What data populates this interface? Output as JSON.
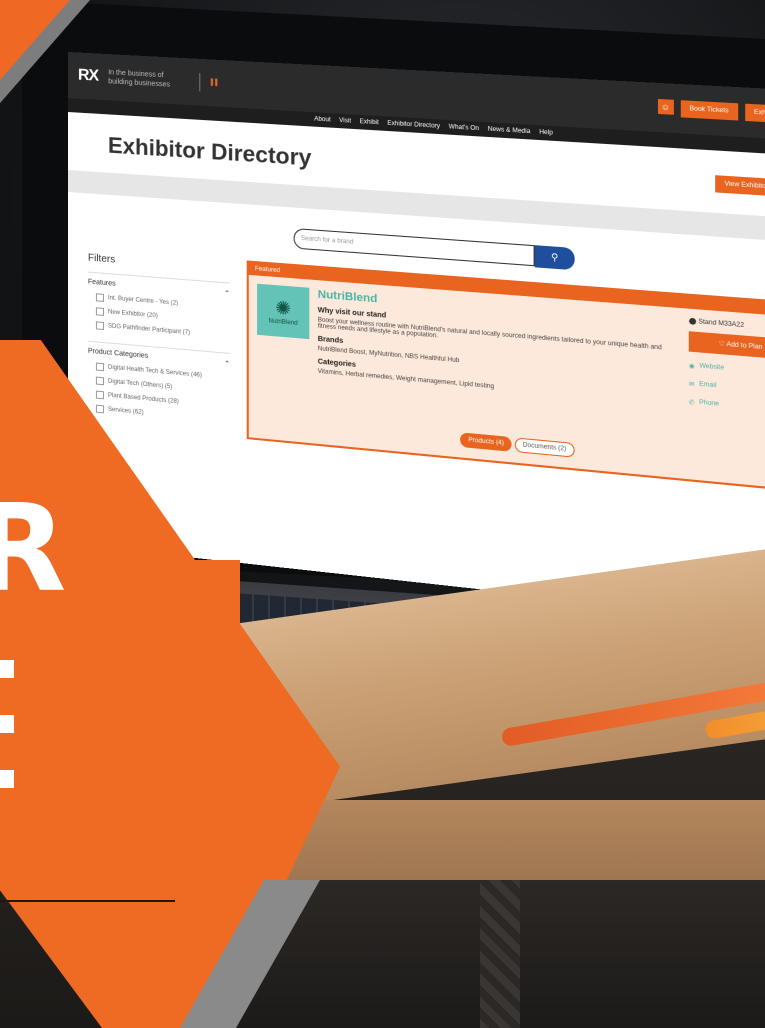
{
  "site": {
    "logo": "RX",
    "tagline": "In the business of building businesses",
    "event_name": "",
    "top_buttons": [
      "Book Tickets",
      "Exhibitor Enquiry"
    ],
    "nav": [
      "About",
      "Visit",
      "Exhibit",
      "Exhibitor Directory",
      "What's On",
      "News & Media",
      "Help"
    ],
    "title": "Exhibitor Directory",
    "cta": "View Exhibitors",
    "search_placeholder": "Search for a brand",
    "filters": {
      "heading": "Filters",
      "groups": [
        {
          "label": "Features",
          "options": [
            "Int. Buyer Centre - Yes (2)",
            "New Exhibitor (20)",
            "SDG Pathfinder Participant (7)"
          ]
        },
        {
          "label": "Product Categories",
          "options": [
            "Digital Health Tech & Services (46)",
            "Digital Tech (Others) (5)",
            "Plant Based Products (28)",
            "Services (62)"
          ]
        }
      ]
    },
    "card": {
      "header": "Featured",
      "logo_text": "NutriBlend",
      "name": "NutriBlend",
      "why_visit_label": "Why visit our stand",
      "why_visit_text": "Boost your wellness routine with NutriBlend's natural and locally sourced ingredients tailored to your unique health and fitness needs and lifestyle as a population.",
      "brands_label": "Brands",
      "brands_text": "NutriBlend Boost, MyNutrition, NBS Healthful Hub",
      "categories_label": "Categories",
      "categories_text": "Vitamins, Herbal remedies, Weight management, Lipid testing",
      "stand": "Stand M33A22",
      "add_label": "Add to Plan",
      "links": [
        "Website",
        "Email",
        "Phone"
      ],
      "tabs": [
        "Products (4)",
        "Documents (2)"
      ]
    }
  },
  "overlay": {
    "letter": "R"
  }
}
